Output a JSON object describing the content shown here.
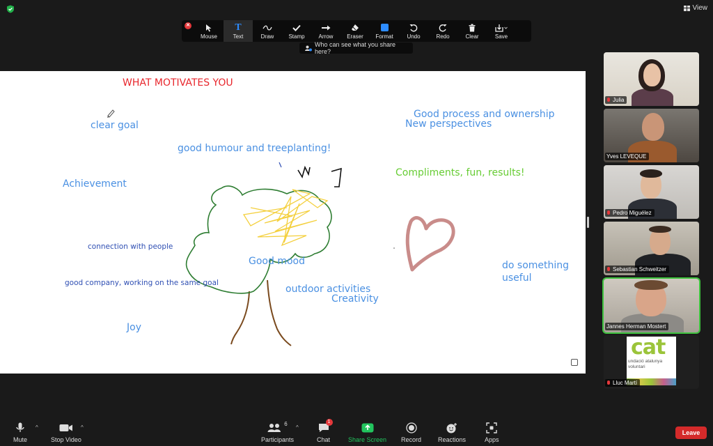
{
  "topbar": {
    "view_label": "View"
  },
  "toolbar": {
    "tools": [
      {
        "label": "Mouse",
        "icon": "cursor-icon"
      },
      {
        "label": "Text",
        "icon": "text-icon"
      },
      {
        "label": "Draw",
        "icon": "draw-icon"
      },
      {
        "label": "Stamp",
        "icon": "stamp-icon"
      },
      {
        "label": "Arrow",
        "icon": "arrow-icon"
      },
      {
        "label": "Eraser",
        "icon": "eraser-icon"
      },
      {
        "label": "Format",
        "icon": "format-icon"
      },
      {
        "label": "Undo",
        "icon": "undo-icon"
      },
      {
        "label": "Redo",
        "icon": "redo-icon"
      },
      {
        "label": "Clear",
        "icon": "trash-icon"
      },
      {
        "label": "Save",
        "icon": "save-icon"
      }
    ],
    "active_tool": "Text",
    "share_hint": "Who can see what you share here?"
  },
  "whiteboard": {
    "title": "WHAT MOTIVATES YOU",
    "notes": [
      {
        "text": "clear goal",
        "color": "#4a90e2"
      },
      {
        "text": "good humour and treeplanting!",
        "color": "#4a90e2"
      },
      {
        "text": "Achievement",
        "color": "#4a90e2"
      },
      {
        "text": "connection with people",
        "color": "#2f4fb3"
      },
      {
        "text": "good company, working on the same goal",
        "color": "#2f4fb3"
      },
      {
        "text": "Joy",
        "color": "#4a90e2"
      },
      {
        "text": "Good mood",
        "color": "#4a90e2"
      },
      {
        "text": "outdoor activities",
        "color": "#4a90e2"
      },
      {
        "text": "Creativity",
        "color": "#4a90e2"
      },
      {
        "text": "Good process and ownership",
        "color": "#4a90e2"
      },
      {
        "text": "New perspectives",
        "color": "#4a90e2"
      },
      {
        "text": "Compliments, fun, results!",
        "color": "#66cc33"
      },
      {
        "text": "do something",
        "color": "#4a90e2"
      },
      {
        "text": "useful",
        "color": "#4a90e2"
      }
    ],
    "title_color": "#e8262c"
  },
  "participants": [
    {
      "name": "Julia",
      "muted": true
    },
    {
      "name": "Yves LEVEQUE",
      "muted": false
    },
    {
      "name": "Pedro Miguélez",
      "muted": true
    },
    {
      "name": "Sebastian Schweitzer",
      "muted": true
    },
    {
      "name": "Jannes Herman Mostert",
      "muted": false,
      "speaking": true
    },
    {
      "name": "Lluc Martí",
      "muted": true,
      "logo_text": "cat",
      "logo_sub": "undació atalunya voluntari"
    }
  ],
  "bottombar": {
    "mute": "Mute",
    "stop_video": "Stop Video",
    "participants": "Participants",
    "participants_count": "6",
    "chat": "Chat",
    "chat_badge": "1",
    "share_screen": "Share Screen",
    "record": "Record",
    "reactions": "Reactions",
    "apps": "Apps",
    "leave": "Leave"
  },
  "colors": {
    "accent": "#2d8cff",
    "share_green": "#22c55e",
    "leave_red": "#d42a2a"
  }
}
